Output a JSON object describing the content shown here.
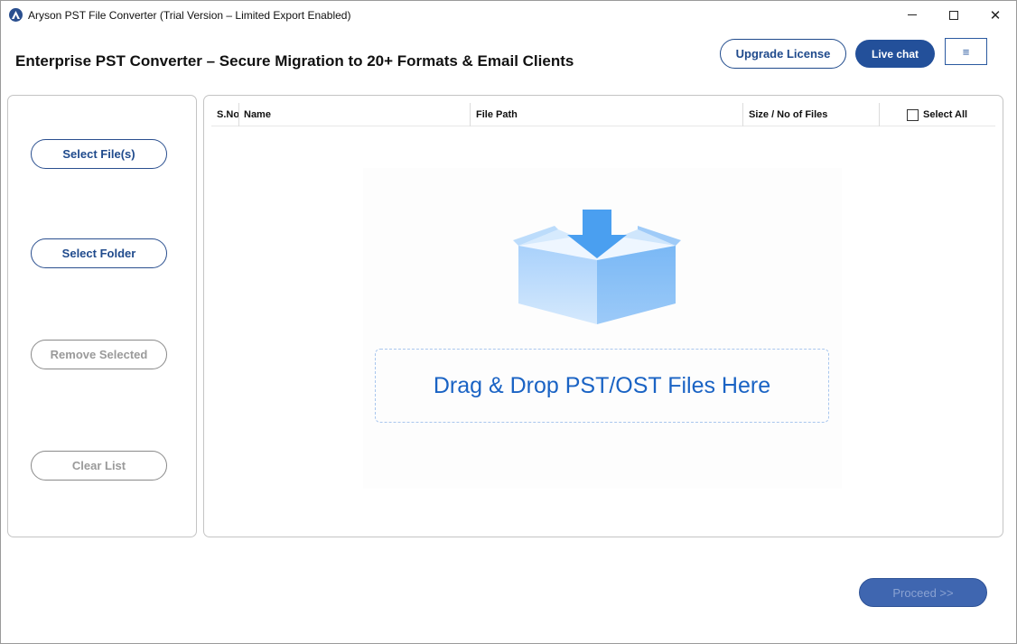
{
  "window": {
    "title": "Aryson PST File Converter (Trial Version – Limited Export Enabled)",
    "minimize_icon": "minimize-icon",
    "maximize_icon": "maximize-icon",
    "close_icon": "close-icon",
    "close_glyph": "✕"
  },
  "header": {
    "title": "Enterprise PST Converter – Secure Migration to 20+ Formats & Email Clients",
    "upgrade_label": "Upgrade License",
    "livechat_label": "Live chat",
    "menu_glyph": "≡"
  },
  "sidebar": {
    "select_files_label": "Select File(s)",
    "select_folder_label": "Select Folder",
    "remove_selected_label": "Remove Selected",
    "clear_list_label": "Clear List"
  },
  "table": {
    "columns": {
      "sno": "S.No",
      "name": "Name",
      "path": "File Path",
      "size": "Size / No of Files"
    },
    "select_all_label": "Select All",
    "select_all_checked": false,
    "rows": []
  },
  "dropzone": {
    "text": "Drag & Drop PST/OST Files Here",
    "icon": "download-box-icon"
  },
  "footer": {
    "proceed_label": "Proceed >>"
  },
  "colors": {
    "primary": "#23509a",
    "accent_text": "#1a63c4",
    "disabled": "#9a9a9a"
  }
}
